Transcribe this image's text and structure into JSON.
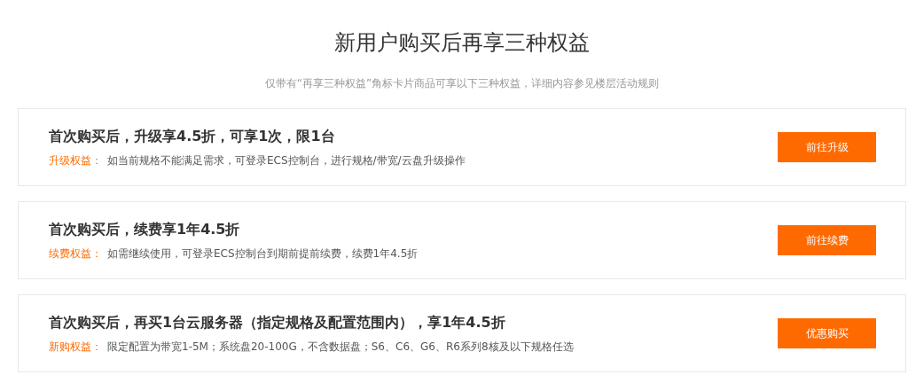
{
  "heading": "新用户购买后再享三种权益",
  "subheading": "仅带有“再享三种权益”角标卡片商品可享以下三种权益，详细内容参见楼层活动规则",
  "benefits": [
    {
      "title": "首次购买后，升级享4.5折，可享1次，限1台",
      "label": "升级权益：",
      "description": "如当前规格不能满足需求，可登录ECS控制台，进行规格/带宽/云盘升级操作",
      "button": "前往升级"
    },
    {
      "title": "首次购买后，续费享1年4.5折",
      "label": "续费权益：",
      "description": "如需继续使用，可登录ECS控制台到期前提前续费，续费1年4.5折",
      "button": "前往续费"
    },
    {
      "title": "首次购买后，再买1台云服务器（指定规格及配置范围内），享1年4.5折",
      "label": "新购权益：",
      "description": "限定配置为带宽1-5M；系统盘20-100G，不含数据盘；S6、C6、G6、R6系列8核及以下规格任选",
      "button": "优惠购买"
    }
  ]
}
